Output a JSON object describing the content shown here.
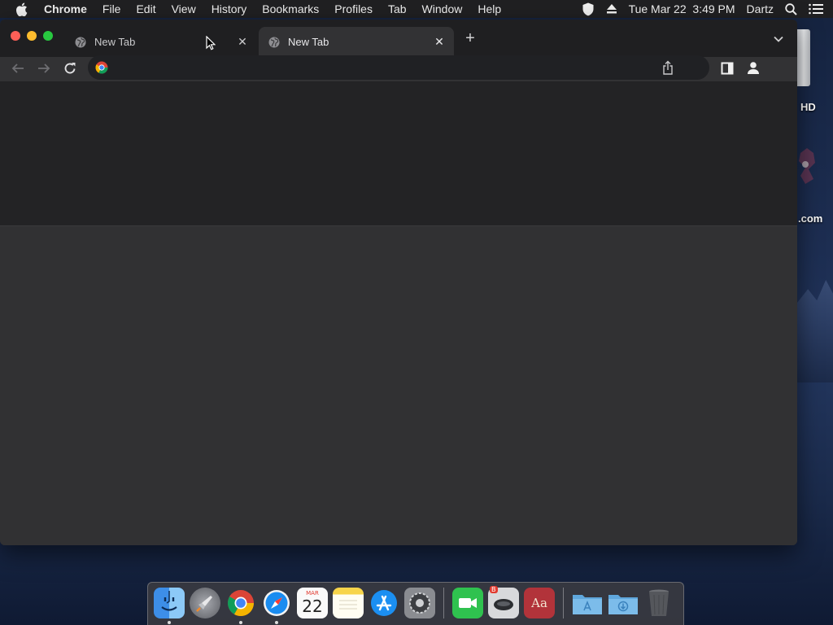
{
  "menubar": {
    "apple_icon": "apple-logo-icon",
    "app_name": "Chrome",
    "items": [
      "File",
      "Edit",
      "View",
      "History",
      "Bookmarks",
      "Profiles",
      "Tab",
      "Window",
      "Help"
    ],
    "status": {
      "icons": [
        "shield-icon",
        "eject-icon"
      ],
      "datetime": "Tue Mar 22  3:49 PM",
      "user": "Dartz",
      "trailing_icons": [
        "spotlight-search-icon",
        "control-center-icon"
      ]
    }
  },
  "desktop": {
    "labels": [
      "HD",
      ".com"
    ]
  },
  "browser": {
    "tabs": [
      {
        "label": "New Tab",
        "favicon": "globe-icon",
        "active": false
      },
      {
        "label": "New Tab",
        "favicon": "globe-icon",
        "active": true
      }
    ],
    "toolbar": {
      "nav_icons": [
        "back-arrow-icon",
        "forward-arrow-icon",
        "reload-icon"
      ],
      "omnibox": {
        "value": "",
        "placeholder": "",
        "leading_icon": "google-icon",
        "trailing_icon": "share-icon"
      },
      "right_icons": [
        "side-panel-icon",
        "profile-icon"
      ]
    },
    "colors": {
      "tabstrip": "#1f1f21",
      "active_tab": "#323234",
      "omnibox": "#202124",
      "content_top": "#232325",
      "content_bottom": "#313133"
    }
  },
  "dock": {
    "apps": [
      {
        "name": "Finder",
        "icon": "finder-icon",
        "running": true
      },
      {
        "name": "Launchpad",
        "icon": "launchpad-icon",
        "running": false
      },
      {
        "name": "Google Chrome",
        "icon": "chrome-icon",
        "running": true
      },
      {
        "name": "Safari",
        "icon": "safari-icon",
        "running": true
      },
      {
        "name": "Calendar",
        "icon": "calendar-icon",
        "running": false,
        "month": "MAR",
        "day": "22"
      },
      {
        "name": "Notes",
        "icon": "notes-icon",
        "running": false
      },
      {
        "name": "App Store",
        "icon": "app-store-icon",
        "running": false
      },
      {
        "name": "System Preferences",
        "icon": "system-preferences-icon",
        "running": false
      },
      {
        "name": "FaceTime",
        "icon": "facetime-icon",
        "running": false
      },
      {
        "name": "Bluebird",
        "icon": "bluebird-icon",
        "running": false,
        "badge": "B"
      },
      {
        "name": "Dictionary",
        "icon": "dictionary-icon",
        "running": false,
        "glyph": "Aa"
      },
      {
        "name": "Applications",
        "icon": "applications-folder-icon",
        "running": false
      },
      {
        "name": "Downloads",
        "icon": "downloads-folder-icon",
        "running": false
      },
      {
        "name": "Trash",
        "icon": "trash-icon",
        "running": false
      }
    ]
  }
}
